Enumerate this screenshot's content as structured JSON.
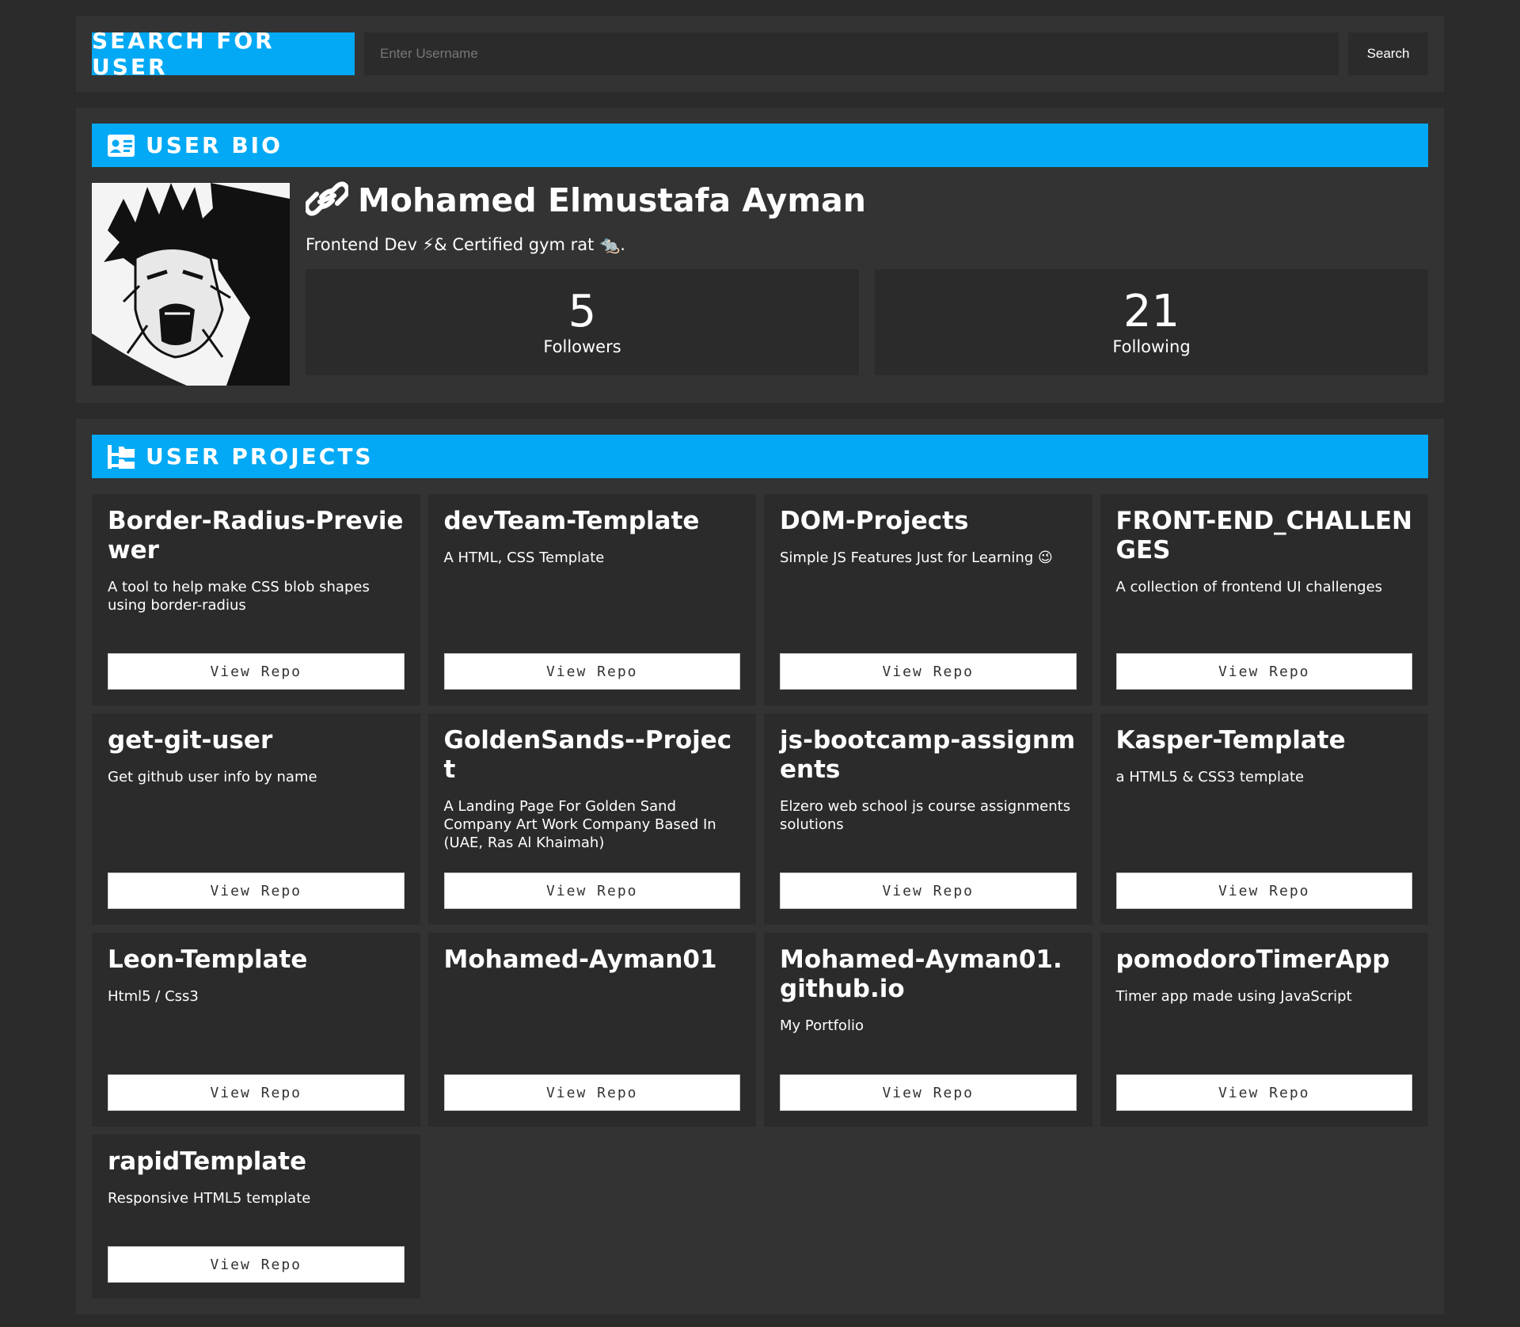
{
  "search": {
    "title": "Search For User",
    "placeholder": "Enter Username",
    "button_label": "Search"
  },
  "bio": {
    "header": "User Bio",
    "name": "Mohamed Elmustafa Ayman",
    "bio_text": "Frontend Dev ⚡& Certified gym rat 🐀.",
    "followers": {
      "count": "5",
      "label": "Followers"
    },
    "following": {
      "count": "21",
      "label": "Following"
    }
  },
  "projects": {
    "header": "User Projects",
    "view_label": "View Repo",
    "items": [
      {
        "name": "Border-Radius-Previewer",
        "description": "A tool to help make CSS blob shapes using border-radius"
      },
      {
        "name": "devTeam-Template",
        "description": "A HTML, CSS Template"
      },
      {
        "name": "DOM-Projects",
        "description": "Simple JS Features Just for Learning 😉"
      },
      {
        "name": "FRONT-END_CHALLENGES",
        "description": "A collection of frontend UI challenges"
      },
      {
        "name": "get-git-user",
        "description": "Get github user info by name"
      },
      {
        "name": "GoldenSands--Project",
        "description": "A Landing Page For Golden Sand Company Art Work Company Based In (UAE, Ras Al Khaimah)"
      },
      {
        "name": "js-bootcamp-assignments",
        "description": "Elzero web school js course assignments solutions"
      },
      {
        "name": "Kasper-Template",
        "description": "a HTML5 & CSS3 template"
      },
      {
        "name": "Leon-Template",
        "description": "Html5 / Css3"
      },
      {
        "name": "Mohamed-Ayman01",
        "description": ""
      },
      {
        "name": "Mohamed-Ayman01.github.io",
        "description": "My Portfolio"
      },
      {
        "name": "pomodoroTimerApp",
        "description": "Timer app made using JavaScript"
      },
      {
        "name": "rapidTemplate",
        "description": "Responsive HTML5 template"
      }
    ]
  },
  "colors": {
    "accent": "#03a9f4",
    "background": "#2b2b2b",
    "panel": "#333333"
  }
}
